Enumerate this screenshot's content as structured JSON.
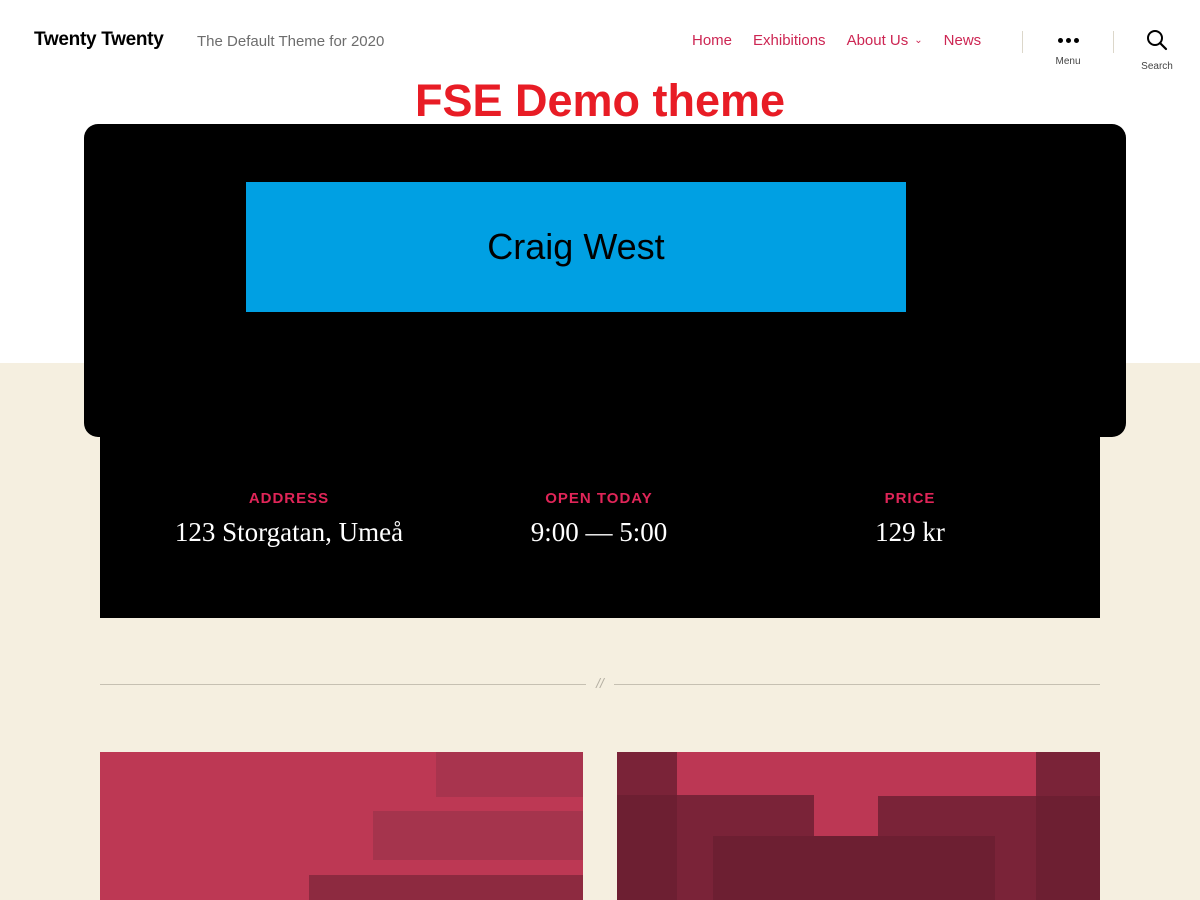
{
  "header": {
    "site_title": "Twenty Twenty",
    "site_description": "The Default Theme for 2020",
    "nav": [
      {
        "label": "Home"
      },
      {
        "label": "Exhibitions"
      },
      {
        "label": "About Us",
        "has_submenu": true
      },
      {
        "label": "News"
      }
    ],
    "menu_label": "Menu",
    "search_label": "Search"
  },
  "demo_heading": "FSE Demo theme",
  "cover": {
    "name": "Craig West"
  },
  "info": {
    "address_label": "ADDRESS",
    "address_value": "123 Storgatan, Umeå",
    "hours_label": "OPEN TODAY",
    "hours_value": "9:00 — 5:00",
    "price_label": "PRICE",
    "price_value": "129 kr"
  },
  "separator_mark": "//",
  "colors": {
    "accent": "#cd2653",
    "demo_heading": "#e81c25",
    "name_box": "#00a0e3",
    "beige": "#f5efe0"
  }
}
